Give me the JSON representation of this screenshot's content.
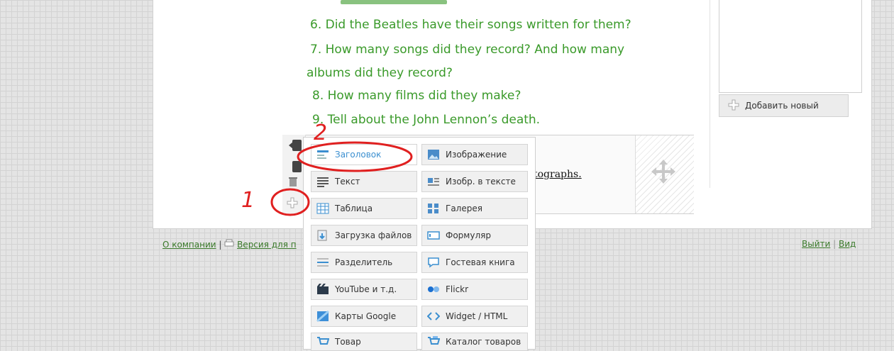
{
  "questions": [
    "6. Did the Beatles have their songs written for them?",
    "7. How many songs did they record? And how many",
    "albums did they record?",
    "8. How many films did they make?",
    "9. Tell about the John Lennon’s death."
  ],
  "sidebar": {
    "add_new_label": "Добавить новый"
  },
  "block": {
    "link_fragment": "tographs."
  },
  "menu": {
    "items": [
      {
        "label": "Заголовок",
        "icon": "heading-icon"
      },
      {
        "label": "Изображение",
        "icon": "image-icon"
      },
      {
        "label": "Текст",
        "icon": "text-icon"
      },
      {
        "label": "Изобр. в тексте",
        "icon": "image-in-text-icon"
      },
      {
        "label": "Таблица",
        "icon": "table-icon"
      },
      {
        "label": "Галерея",
        "icon": "gallery-icon"
      },
      {
        "label": "Загрузка файлов",
        "icon": "file-upload-icon"
      },
      {
        "label": "Формуляр",
        "icon": "form-icon"
      },
      {
        "label": "Разделитель",
        "icon": "divider-icon"
      },
      {
        "label": "Гостевая книга",
        "icon": "guestbook-icon"
      },
      {
        "label": "YouTube и т.д.",
        "icon": "youtube-icon"
      },
      {
        "label": "Flickr",
        "icon": "flickr-icon"
      },
      {
        "label": "Карты Google",
        "icon": "google-maps-icon"
      },
      {
        "label": "Widget / HTML",
        "icon": "widget-html-icon"
      },
      {
        "label": "Товар",
        "icon": "product-icon"
      },
      {
        "label": "Каталог товаров",
        "icon": "catalog-icon"
      }
    ]
  },
  "footer": {
    "about": "О компании",
    "separator": "|",
    "print_version": "Версия для п",
    "logout": "Выйти",
    "view": "Вид"
  },
  "annotations": {
    "mark_one": "1",
    "mark_two": "2",
    "color": "#e02020"
  },
  "colors": {
    "question_text": "#3a9a2a",
    "active_item": "#3b8fd0"
  }
}
